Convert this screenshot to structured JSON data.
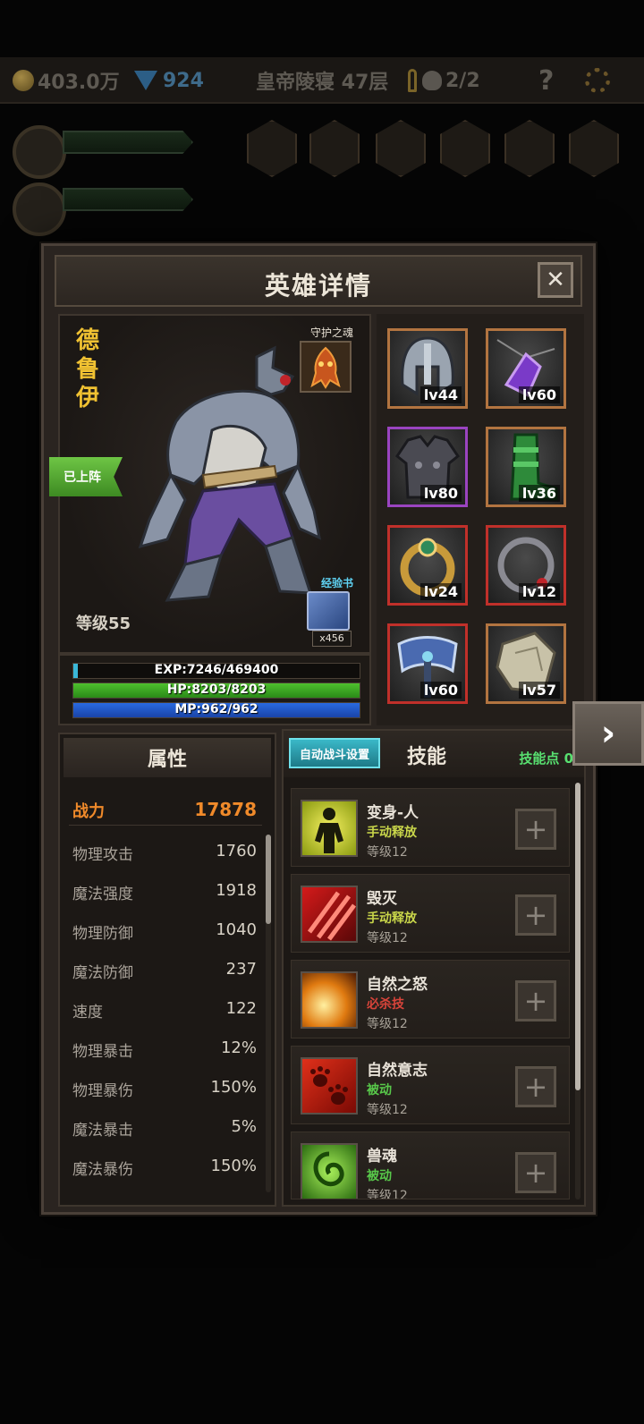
{
  "topbar": {
    "gold": "403.0万",
    "gems": "924",
    "location": "皇帝陵寝 47层",
    "keys_skull": "2/2",
    "help": "?"
  },
  "modal": {
    "title": "英雄详情",
    "close": "✕"
  },
  "hero": {
    "name": "德鲁伊",
    "soul_label": "守护之魂",
    "status": "已上阵",
    "exp_book_label": "经验书",
    "exp_book_count": "x456",
    "level": "等级55",
    "exp_text": "EXP:7246/469400",
    "exp_fraction": 0.0154,
    "hp_text": "HP:8203/8203",
    "hp_fraction": 1.0,
    "mp_text": "MP:962/962",
    "mp_fraction": 1.0
  },
  "equipment": [
    {
      "icon": "helmet-icon",
      "level": "lv44",
      "rarity": "orange"
    },
    {
      "icon": "amulet-icon",
      "level": "lv60",
      "rarity": "orange"
    },
    {
      "icon": "armor-icon",
      "level": "lv80",
      "rarity": "purple"
    },
    {
      "icon": "boots-icon",
      "level": "lv36",
      "rarity": "orange"
    },
    {
      "icon": "ring-icon",
      "level": "lv24",
      "rarity": "red"
    },
    {
      "icon": "bracelet-icon",
      "level": "lv12",
      "rarity": "red"
    },
    {
      "icon": "axe-icon",
      "level": "lv60",
      "rarity": "red"
    },
    {
      "icon": "shield-icon",
      "level": "lv57",
      "rarity": "orange"
    }
  ],
  "attributes": {
    "header": "属性",
    "power_label": "战力",
    "power_value": "17878",
    "rows": [
      {
        "label": "物理攻击",
        "value": "1760"
      },
      {
        "label": "魔法强度",
        "value": "1918"
      },
      {
        "label": "物理防御",
        "value": "1040"
      },
      {
        "label": "魔法防御",
        "value": "237"
      },
      {
        "label": "速度",
        "value": "122"
      },
      {
        "label": "物理暴击",
        "value": "12%"
      },
      {
        "label": "物理暴伤",
        "value": "150%"
      },
      {
        "label": "魔法暴击",
        "value": "5%"
      },
      {
        "label": "魔法暴伤",
        "value": "150%"
      }
    ]
  },
  "skills": {
    "auto_battle_button": "自动战斗设置",
    "header": "技能",
    "points_label": "技能点",
    "points_value": "0",
    "items": [
      {
        "name": "变身-人",
        "type": "手动释放",
        "type_color": "#c9d64a",
        "level": "等级12",
        "icon": "transform-human-icon"
      },
      {
        "name": "毁灭",
        "type": "手动释放",
        "type_color": "#c9d64a",
        "level": "等级12",
        "icon": "claw-slash-icon"
      },
      {
        "name": "自然之怒",
        "type": "必杀技",
        "type_color": "#d8443a",
        "level": "等级12",
        "icon": "nature-wrath-icon"
      },
      {
        "name": "自然意志",
        "type": "被动",
        "type_color": "#58c84a",
        "level": "等级12",
        "icon": "paw-prints-icon"
      },
      {
        "name": "兽魂",
        "type": "被动",
        "type_color": "#58c84a",
        "level": "等级12",
        "icon": "beast-soul-icon"
      }
    ],
    "add_label": "+"
  },
  "next_label": "›"
}
